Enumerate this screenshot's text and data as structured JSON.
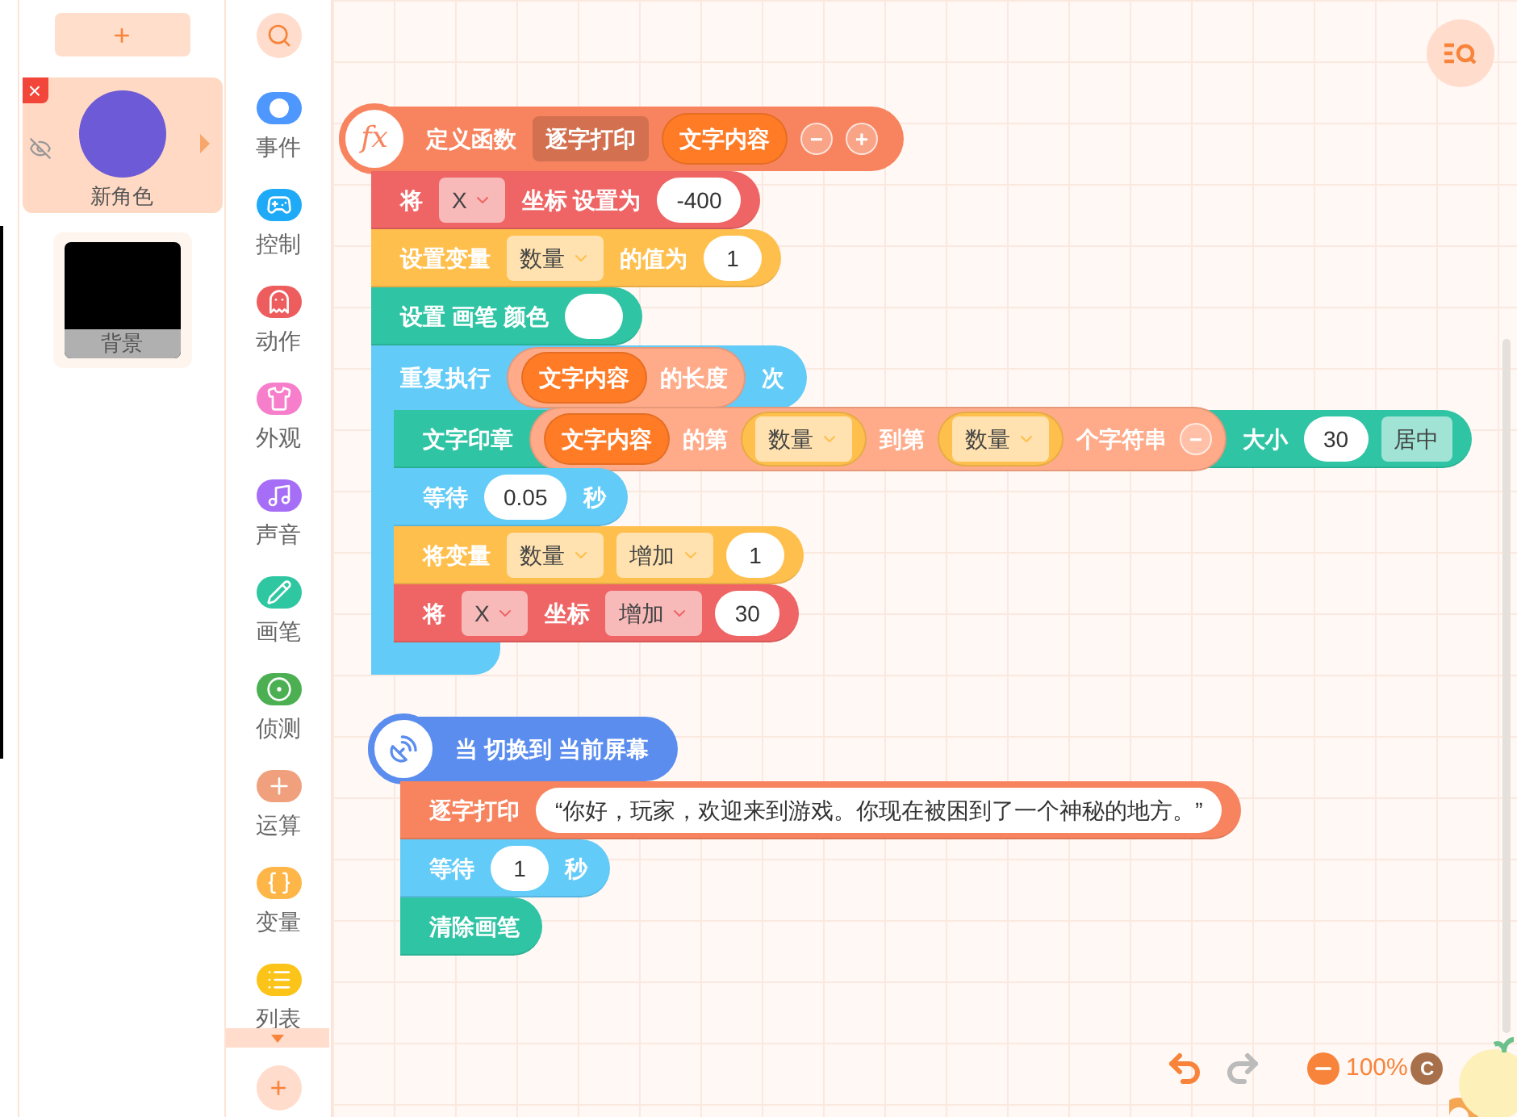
{
  "sprite_panel": {
    "add_button": "+",
    "sprites": [
      {
        "kind": "sprite",
        "name": "新角色",
        "selected": true,
        "delete": "×"
      },
      {
        "kind": "backdrop",
        "name": "背景",
        "selected": false
      }
    ]
  },
  "categories": [
    {
      "label": "事件",
      "color": "#4d97ff"
    },
    {
      "label": "控制",
      "color": "#1faaf7"
    },
    {
      "label": "动作",
      "color": "#ee5d5d"
    },
    {
      "label": "外观",
      "color": "#f67ecb"
    },
    {
      "label": "声音",
      "color": "#a66ef6"
    },
    {
      "label": "画笔",
      "color": "#2ec7a1"
    },
    {
      "label": "侦测",
      "color": "#4cb052"
    },
    {
      "label": "运算",
      "color": "#f0a07c"
    },
    {
      "label": "变量",
      "color": "#ffb648"
    },
    {
      "label": "列表",
      "color": "#fcc419"
    }
  ],
  "category_add": "+",
  "scripts": [
    {
      "blocks": [
        {
          "kind": "define",
          "color": "#f7845f",
          "icon_text": "fx",
          "parts": [
            {
              "kind": "text",
              "text": "定义函数"
            },
            {
              "kind": "name",
              "text": "逐字打印"
            },
            {
              "kind": "reporter",
              "color": "#ff7b26",
              "parts": [
                {
                  "kind": "text",
                  "text": "文字内容"
                }
              ]
            },
            {
              "kind": "button",
              "text": "−"
            },
            {
              "kind": "button",
              "text": "+"
            }
          ]
        },
        {
          "kind": "command",
          "color": "#ef6464",
          "parts": [
            {
              "kind": "text",
              "text": "将"
            },
            {
              "kind": "dropdown",
              "text": "X"
            },
            {
              "kind": "text",
              "text": "坐标 设置为"
            },
            {
              "kind": "input",
              "text": "-400"
            }
          ]
        },
        {
          "kind": "command",
          "color": "#ffbf4d",
          "parts": [
            {
              "kind": "text",
              "text": "设置变量"
            },
            {
              "kind": "dropdown",
              "text": "数量"
            },
            {
              "kind": "text",
              "text": "的值为"
            },
            {
              "kind": "input",
              "text": "1"
            }
          ]
        },
        {
          "kind": "command",
          "color": "#2ec4a4",
          "parts": [
            {
              "kind": "text",
              "text": "设置 画笔 颜色"
            },
            {
              "kind": "color_input"
            }
          ]
        },
        {
          "kind": "loop",
          "color": "#62cbf8",
          "parts": [
            {
              "kind": "text",
              "text": "重复执行"
            },
            {
              "kind": "reporter",
              "color": "#ffab8a",
              "parts": [
                {
                  "kind": "reporter",
                  "color": "#ff7b26",
                  "parts": [
                    {
                      "kind": "text",
                      "text": "文字内容"
                    }
                  ]
                },
                {
                  "kind": "text",
                  "text": "的长度"
                }
              ]
            },
            {
              "kind": "text",
              "text": "次"
            }
          ],
          "children": [
            {
              "kind": "command",
              "color": "#2ec4a4",
              "parts": [
                {
                  "kind": "text",
                  "text": "文字印章"
                },
                {
                  "kind": "reporter",
                  "color": "#ffab8a",
                  "parts": [
                    {
                      "kind": "reporter",
                      "color": "#ff7b26",
                      "parts": [
                        {
                          "kind": "text",
                          "text": "文字内容"
                        }
                      ]
                    },
                    {
                      "kind": "text",
                      "text": "的第"
                    },
                    {
                      "kind": "reporter",
                      "color": "#ffbf4d",
                      "parts": [
                        {
                          "kind": "dropdown",
                          "text": "数量"
                        }
                      ]
                    },
                    {
                      "kind": "text",
                      "text": "到第"
                    },
                    {
                      "kind": "reporter",
                      "color": "#ffbf4d",
                      "parts": [
                        {
                          "kind": "dropdown",
                          "text": "数量"
                        }
                      ]
                    },
                    {
                      "kind": "text",
                      "text": "个字符串"
                    },
                    {
                      "kind": "button",
                      "text": "−"
                    }
                  ]
                },
                {
                  "kind": "text",
                  "text": "大小"
                },
                {
                  "kind": "input",
                  "text": "30"
                },
                {
                  "kind": "dropdown",
                  "text": "居中",
                  "arrow": false
                }
              ]
            },
            {
              "kind": "command",
              "color": "#62cbf8",
              "parts": [
                {
                  "kind": "text",
                  "text": "等待"
                },
                {
                  "kind": "input",
                  "text": "0.05"
                },
                {
                  "kind": "text",
                  "text": "秒"
                }
              ]
            },
            {
              "kind": "command",
              "color": "#ffbf4d",
              "parts": [
                {
                  "kind": "text",
                  "text": "将变量"
                },
                {
                  "kind": "dropdown",
                  "text": "数量"
                },
                {
                  "kind": "dropdown",
                  "text": "增加"
                },
                {
                  "kind": "input",
                  "text": "1"
                }
              ]
            },
            {
              "kind": "command",
              "color": "#ef6464",
              "parts": [
                {
                  "kind": "text",
                  "text": "将"
                },
                {
                  "kind": "dropdown",
                  "text": "X"
                },
                {
                  "kind": "text",
                  "text": "坐标"
                },
                {
                  "kind": "dropdown",
                  "text": "增加"
                },
                {
                  "kind": "input",
                  "text": "30"
                }
              ]
            }
          ]
        }
      ]
    },
    {
      "blocks": [
        {
          "kind": "event",
          "color": "#5b8def",
          "parts": [
            {
              "kind": "text",
              "text": "当 切换到 当前屏幕"
            }
          ]
        },
        {
          "kind": "command",
          "color": "#f7845f",
          "parts": [
            {
              "kind": "text",
              "text": "逐字打印"
            },
            {
              "kind": "input",
              "text": "“你好，玩家，欢迎来到游戏。你现在被困到了一个神秘的地方。”"
            }
          ]
        },
        {
          "kind": "command",
          "color": "#62cbf8",
          "parts": [
            {
              "kind": "text",
              "text": "等待"
            },
            {
              "kind": "input",
              "text": "1"
            },
            {
              "kind": "text",
              "text": "秒"
            }
          ]
        },
        {
          "kind": "command",
          "color": "#2ec4a4",
          "parts": [
            {
              "kind": "text",
              "text": "清除画笔"
            }
          ]
        }
      ]
    }
  ],
  "zoom_level": "100%",
  "badge": "C"
}
